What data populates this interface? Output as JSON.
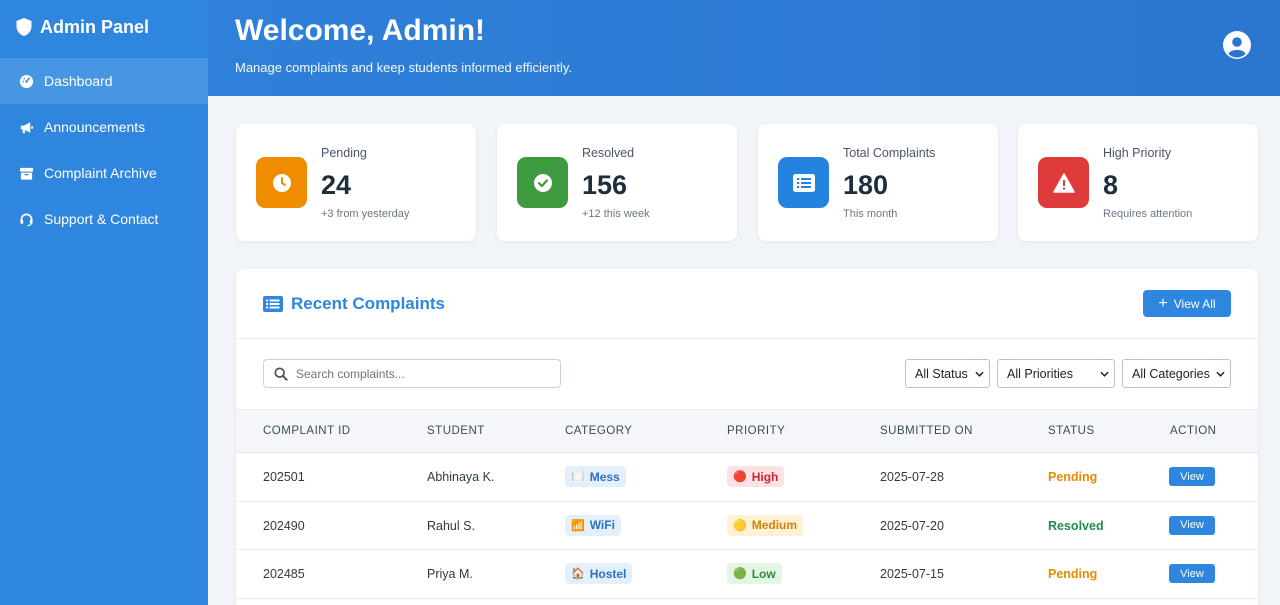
{
  "sidebar": {
    "brand": "Admin Panel",
    "items": [
      {
        "label": "Dashboard",
        "icon": "dashboard-icon",
        "active": true
      },
      {
        "label": "Announcements",
        "icon": "megaphone-icon"
      },
      {
        "label": "Complaint Archive",
        "icon": "archive-icon"
      },
      {
        "label": "Support & Contact",
        "icon": "headset-icon"
      }
    ]
  },
  "header": {
    "title": "Welcome, Admin!",
    "subtitle": "Manage complaints and keep students informed efficiently."
  },
  "stats": [
    {
      "label": "Pending",
      "value": "24",
      "sub": "+3 from yesterday",
      "color": "#f08c00",
      "icon": "clock-icon"
    },
    {
      "label": "Resolved",
      "value": "156",
      "sub": "+12 this week",
      "color": "#3e9a3e",
      "icon": "check-circle-icon"
    },
    {
      "label": "Total Complaints",
      "value": "180",
      "sub": "This month",
      "color": "#2583e0",
      "icon": "list-icon"
    },
    {
      "label": "High Priority",
      "value": "8",
      "sub": "Requires attention",
      "color": "#e03b3b",
      "icon": "warning-icon"
    }
  ],
  "complaints": {
    "title": "Recent Complaints",
    "view_all": "View All",
    "search_placeholder": "Search complaints...",
    "filters": [
      "All Status",
      "All Priorities",
      "All Categories"
    ],
    "columns": [
      "COMPLAINT ID",
      "STUDENT",
      "CATEGORY",
      "PRIORITY",
      "SUBMITTED ON",
      "STATUS",
      "ACTION"
    ],
    "rows": [
      {
        "id": "202501",
        "student": "Abhinaya K.",
        "category": "Mess",
        "category_emoji": "🍽️",
        "priority": "High",
        "priority_emoji": "🔴",
        "date": "2025-07-28",
        "status": "Pending",
        "action": "View"
      },
      {
        "id": "202490",
        "student": "Rahul S.",
        "category": "WiFi",
        "category_emoji": "📶",
        "priority": "Medium",
        "priority_emoji": "🟡",
        "date": "2025-07-20",
        "status": "Resolved",
        "action": "View"
      },
      {
        "id": "202485",
        "student": "Priya M.",
        "category": "Hostel",
        "category_emoji": "🏠",
        "priority": "Low",
        "priority_emoji": "🟢",
        "date": "2025-07-15",
        "status": "Pending",
        "action": "View"
      }
    ]
  },
  "colors": {
    "primary": "#2e86de",
    "pending": "#e68a00",
    "resolved": "#1e8f4a",
    "high_bg": "#fde2e4",
    "high_fg": "#c62832",
    "medium_bg": "#fff1d6",
    "medium_fg": "#d08400",
    "low_bg": "#e3f6e6",
    "low_fg": "#2e8b3a",
    "category_bg": "#e3f0fc",
    "category_fg": "#2e6fc0"
  }
}
